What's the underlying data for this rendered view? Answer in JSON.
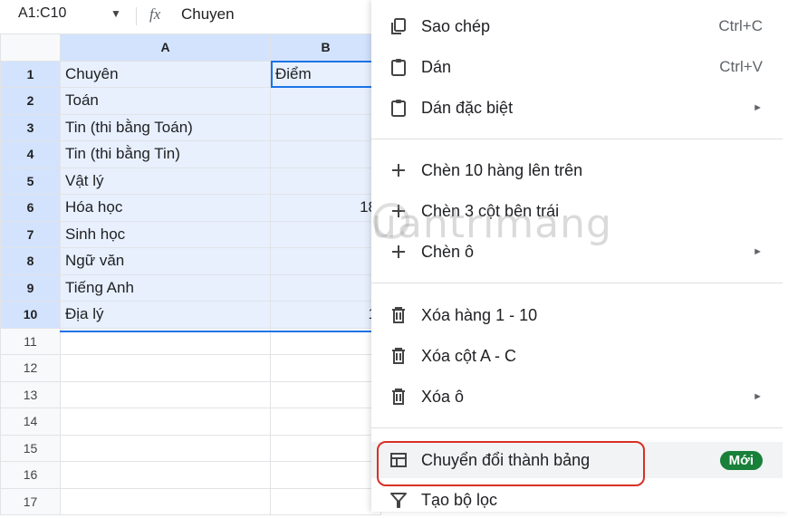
{
  "formula_bar": {
    "name_box": "A1:C10",
    "fx": "fx",
    "content": "Chuyen"
  },
  "grid": {
    "columns": [
      "A",
      "B"
    ],
    "rows": [
      {
        "num": "1",
        "a": "Chuyên",
        "b": "Điểm"
      },
      {
        "num": "2",
        "a": "Toán",
        "b": ""
      },
      {
        "num": "3",
        "a": "Tin (thi bằng Toán)",
        "b": ""
      },
      {
        "num": "4",
        "a": "Tin (thi bằng Tin)",
        "b": ""
      },
      {
        "num": "5",
        "a": "Vật lý",
        "b": ""
      },
      {
        "num": "6",
        "a": "Hóa học",
        "b": "18"
      },
      {
        "num": "7",
        "a": "Sinh học",
        "b": ""
      },
      {
        "num": "8",
        "a": "Ngữ văn",
        "b": ""
      },
      {
        "num": "9",
        "a": "Tiếng Anh",
        "b": ""
      },
      {
        "num": "10",
        "a": "Địa lý",
        "b": "1"
      },
      {
        "num": "11",
        "a": "",
        "b": ""
      },
      {
        "num": "12",
        "a": "",
        "b": ""
      },
      {
        "num": "13",
        "a": "",
        "b": ""
      },
      {
        "num": "14",
        "a": "",
        "b": ""
      },
      {
        "num": "15",
        "a": "",
        "b": ""
      },
      {
        "num": "16",
        "a": "",
        "b": ""
      },
      {
        "num": "17",
        "a": "",
        "b": ""
      }
    ]
  },
  "menu": {
    "copy": {
      "label": "Sao chép",
      "shortcut": "Ctrl+C"
    },
    "paste": {
      "label": "Dán",
      "shortcut": "Ctrl+V"
    },
    "paste_special": {
      "label": "Dán đặc biệt"
    },
    "insert_rows": {
      "label": "Chèn 10 hàng lên trên"
    },
    "insert_cols": {
      "label": "Chèn 3 cột bên trái"
    },
    "insert_cells": {
      "label": "Chèn ô"
    },
    "delete_rows": {
      "label": "Xóa hàng 1 - 10"
    },
    "delete_cols": {
      "label": "Xóa cột A - C"
    },
    "delete_cells": {
      "label": "Xóa ô"
    },
    "convert_table": {
      "label": "Chuyển đổi thành bảng",
      "badge": "Mới"
    },
    "create_filter": {
      "label": "Tạo bộ lọc"
    },
    "submenu_arrow": "►"
  },
  "watermark": "uantrimang",
  "colors": {
    "selection": "#e8f0fe",
    "selection_header": "#d3e3fd",
    "accent": "#1a73e8",
    "badge": "#188038",
    "callout": "#d93025"
  }
}
